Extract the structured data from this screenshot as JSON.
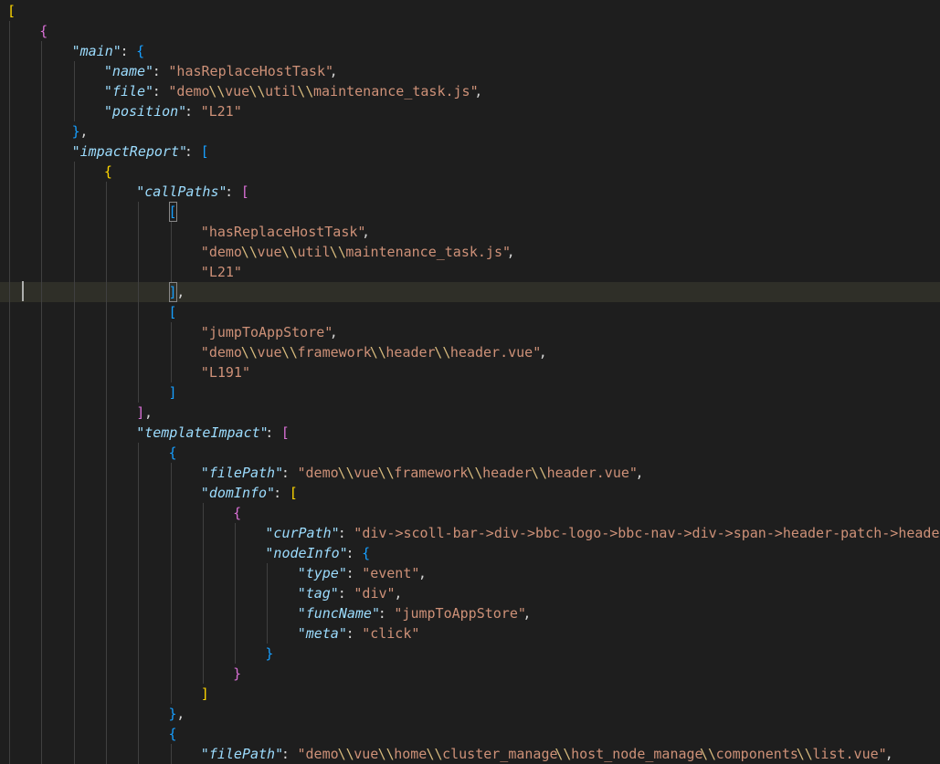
{
  "editor": {
    "language": "json",
    "theme": {
      "background": "#1e1e1e",
      "key_color": "#9cdcfe",
      "string_color": "#ce9178",
      "escape_color": "#d7ba7d",
      "bracket_colors": [
        "#ffd700",
        "#da70d6",
        "#179fff"
      ]
    },
    "current_line": 14,
    "lines": [
      {
        "indent": 0,
        "tokens": [
          {
            "t": "[",
            "c": "b-gold"
          }
        ]
      },
      {
        "indent": 1,
        "tokens": [
          {
            "t": "{",
            "c": "b-purple"
          }
        ]
      },
      {
        "indent": 2,
        "tokens": [
          {
            "t": "\"main\"",
            "c": "t-key"
          },
          {
            "t": ": ",
            "c": "t-punc"
          },
          {
            "t": "{",
            "c": "b-blue"
          }
        ]
      },
      {
        "indent": 3,
        "tokens": [
          {
            "t": "\"name\"",
            "c": "t-key"
          },
          {
            "t": ": ",
            "c": "t-punc"
          },
          {
            "t": "\"hasReplaceHostTask\"",
            "c": "t-str"
          },
          {
            "t": ",",
            "c": "t-punc"
          }
        ]
      },
      {
        "indent": 3,
        "tokens": [
          {
            "t": "\"file\"",
            "c": "t-key"
          },
          {
            "t": ": ",
            "c": "t-punc"
          },
          {
            "t": "\"demo",
            "c": "t-str"
          },
          {
            "t": "\\\\",
            "c": "t-esc"
          },
          {
            "t": "vue",
            "c": "t-str"
          },
          {
            "t": "\\\\",
            "c": "t-esc"
          },
          {
            "t": "util",
            "c": "t-str"
          },
          {
            "t": "\\\\",
            "c": "t-esc"
          },
          {
            "t": "maintenance_task.js\"",
            "c": "t-str"
          },
          {
            "t": ",",
            "c": "t-punc"
          }
        ]
      },
      {
        "indent": 3,
        "tokens": [
          {
            "t": "\"position\"",
            "c": "t-key"
          },
          {
            "t": ": ",
            "c": "t-punc"
          },
          {
            "t": "\"L21\"",
            "c": "t-str"
          }
        ]
      },
      {
        "indent": 2,
        "tokens": [
          {
            "t": "}",
            "c": "b-blue"
          },
          {
            "t": ",",
            "c": "t-punc"
          }
        ]
      },
      {
        "indent": 2,
        "tokens": [
          {
            "t": "\"impactReport\"",
            "c": "t-key"
          },
          {
            "t": ": ",
            "c": "t-punc"
          },
          {
            "t": "[",
            "c": "b-blue"
          }
        ]
      },
      {
        "indent": 3,
        "tokens": [
          {
            "t": "{",
            "c": "b-gold"
          }
        ]
      },
      {
        "indent": 4,
        "tokens": [
          {
            "t": "\"callPaths\"",
            "c": "t-key"
          },
          {
            "t": ": ",
            "c": "t-punc"
          },
          {
            "t": "[",
            "c": "b-purple"
          }
        ]
      },
      {
        "indent": 5,
        "tokens": [
          {
            "t": "[",
            "c": "b-blue",
            "match": true
          }
        ]
      },
      {
        "indent": 6,
        "tokens": [
          {
            "t": "\"hasReplaceHostTask\"",
            "c": "t-str"
          },
          {
            "t": ",",
            "c": "t-punc"
          }
        ]
      },
      {
        "indent": 6,
        "tokens": [
          {
            "t": "\"demo",
            "c": "t-str"
          },
          {
            "t": "\\\\",
            "c": "t-esc"
          },
          {
            "t": "vue",
            "c": "t-str"
          },
          {
            "t": "\\\\",
            "c": "t-esc"
          },
          {
            "t": "util",
            "c": "t-str"
          },
          {
            "t": "\\\\",
            "c": "t-esc"
          },
          {
            "t": "maintenance_task.js\"",
            "c": "t-str"
          },
          {
            "t": ",",
            "c": "t-punc"
          }
        ]
      },
      {
        "indent": 6,
        "tokens": [
          {
            "t": "\"L21\"",
            "c": "t-str"
          }
        ]
      },
      {
        "indent": 5,
        "tokens": [
          {
            "t": "]",
            "c": "b-blue",
            "match": true
          },
          {
            "t": ",",
            "c": "t-punc"
          }
        ]
      },
      {
        "indent": 5,
        "tokens": [
          {
            "t": "[",
            "c": "b-blue"
          }
        ]
      },
      {
        "indent": 6,
        "tokens": [
          {
            "t": "\"jumpToAppStore\"",
            "c": "t-str"
          },
          {
            "t": ",",
            "c": "t-punc"
          }
        ]
      },
      {
        "indent": 6,
        "tokens": [
          {
            "t": "\"demo",
            "c": "t-str"
          },
          {
            "t": "\\\\",
            "c": "t-esc"
          },
          {
            "t": "vue",
            "c": "t-str"
          },
          {
            "t": "\\\\",
            "c": "t-esc"
          },
          {
            "t": "framework",
            "c": "t-str"
          },
          {
            "t": "\\\\",
            "c": "t-esc"
          },
          {
            "t": "header",
            "c": "t-str"
          },
          {
            "t": "\\\\",
            "c": "t-esc"
          },
          {
            "t": "header.vue\"",
            "c": "t-str"
          },
          {
            "t": ",",
            "c": "t-punc"
          }
        ]
      },
      {
        "indent": 6,
        "tokens": [
          {
            "t": "\"L191\"",
            "c": "t-str"
          }
        ]
      },
      {
        "indent": 5,
        "tokens": [
          {
            "t": "]",
            "c": "b-blue"
          }
        ]
      },
      {
        "indent": 4,
        "tokens": [
          {
            "t": "]",
            "c": "b-purple"
          },
          {
            "t": ",",
            "c": "t-punc"
          }
        ]
      },
      {
        "indent": 4,
        "tokens": [
          {
            "t": "\"templateImpact\"",
            "c": "t-key"
          },
          {
            "t": ": ",
            "c": "t-punc"
          },
          {
            "t": "[",
            "c": "b-purple"
          }
        ]
      },
      {
        "indent": 5,
        "tokens": [
          {
            "t": "{",
            "c": "b-blue"
          }
        ]
      },
      {
        "indent": 6,
        "tokens": [
          {
            "t": "\"filePath\"",
            "c": "t-key"
          },
          {
            "t": ": ",
            "c": "t-punc"
          },
          {
            "t": "\"demo",
            "c": "t-str"
          },
          {
            "t": "\\\\",
            "c": "t-esc"
          },
          {
            "t": "vue",
            "c": "t-str"
          },
          {
            "t": "\\\\",
            "c": "t-esc"
          },
          {
            "t": "framework",
            "c": "t-str"
          },
          {
            "t": "\\\\",
            "c": "t-esc"
          },
          {
            "t": "header",
            "c": "t-str"
          },
          {
            "t": "\\\\",
            "c": "t-esc"
          },
          {
            "t": "header.vue\"",
            "c": "t-str"
          },
          {
            "t": ",",
            "c": "t-punc"
          }
        ]
      },
      {
        "indent": 6,
        "tokens": [
          {
            "t": "\"domInfo\"",
            "c": "t-key"
          },
          {
            "t": ": ",
            "c": "t-punc"
          },
          {
            "t": "[",
            "c": "b-gold"
          }
        ]
      },
      {
        "indent": 7,
        "tokens": [
          {
            "t": "{",
            "c": "b-purple"
          }
        ]
      },
      {
        "indent": 8,
        "tokens": [
          {
            "t": "\"curPath\"",
            "c": "t-key"
          },
          {
            "t": ": ",
            "c": "t-punc"
          },
          {
            "t": "\"div->scoll-bar->div->bbc-logo->bbc-nav->div->span->header-patch->header-t",
            "c": "t-str"
          }
        ]
      },
      {
        "indent": 8,
        "tokens": [
          {
            "t": "\"nodeInfo\"",
            "c": "t-key"
          },
          {
            "t": ": ",
            "c": "t-punc"
          },
          {
            "t": "{",
            "c": "b-blue"
          }
        ]
      },
      {
        "indent": 9,
        "tokens": [
          {
            "t": "\"type\"",
            "c": "t-key"
          },
          {
            "t": ": ",
            "c": "t-punc"
          },
          {
            "t": "\"event\"",
            "c": "t-str"
          },
          {
            "t": ",",
            "c": "t-punc"
          }
        ]
      },
      {
        "indent": 9,
        "tokens": [
          {
            "t": "\"tag\"",
            "c": "t-key"
          },
          {
            "t": ": ",
            "c": "t-punc"
          },
          {
            "t": "\"div\"",
            "c": "t-str"
          },
          {
            "t": ",",
            "c": "t-punc"
          }
        ]
      },
      {
        "indent": 9,
        "tokens": [
          {
            "t": "\"funcName\"",
            "c": "t-key"
          },
          {
            "t": ": ",
            "c": "t-punc"
          },
          {
            "t": "\"jumpToAppStore\"",
            "c": "t-str"
          },
          {
            "t": ",",
            "c": "t-punc"
          }
        ]
      },
      {
        "indent": 9,
        "tokens": [
          {
            "t": "\"meta\"",
            "c": "t-key"
          },
          {
            "t": ": ",
            "c": "t-punc"
          },
          {
            "t": "\"click\"",
            "c": "t-str"
          }
        ]
      },
      {
        "indent": 8,
        "tokens": [
          {
            "t": "}",
            "c": "b-blue"
          }
        ]
      },
      {
        "indent": 7,
        "tokens": [
          {
            "t": "}",
            "c": "b-purple"
          }
        ]
      },
      {
        "indent": 6,
        "tokens": [
          {
            "t": "]",
            "c": "b-gold"
          }
        ]
      },
      {
        "indent": 5,
        "tokens": [
          {
            "t": "}",
            "c": "b-blue"
          },
          {
            "t": ",",
            "c": "t-punc"
          }
        ]
      },
      {
        "indent": 5,
        "tokens": [
          {
            "t": "{",
            "c": "b-blue"
          }
        ]
      },
      {
        "indent": 6,
        "tokens": [
          {
            "t": "\"filePath\"",
            "c": "t-key"
          },
          {
            "t": ": ",
            "c": "t-punc"
          },
          {
            "t": "\"demo",
            "c": "t-str"
          },
          {
            "t": "\\\\",
            "c": "t-esc"
          },
          {
            "t": "vue",
            "c": "t-str"
          },
          {
            "t": "\\\\",
            "c": "t-esc"
          },
          {
            "t": "home",
            "c": "t-str"
          },
          {
            "t": "\\\\",
            "c": "t-esc"
          },
          {
            "t": "cluster_manage",
            "c": "t-str"
          },
          {
            "t": "\\\\",
            "c": "t-esc"
          },
          {
            "t": "host_node_manage",
            "c": "t-str"
          },
          {
            "t": "\\\\",
            "c": "t-esc"
          },
          {
            "t": "components",
            "c": "t-str"
          },
          {
            "t": "\\\\",
            "c": "t-esc"
          },
          {
            "t": "list.vue\"",
            "c": "t-str"
          },
          {
            "t": ",",
            "c": "t-punc"
          }
        ]
      }
    ]
  }
}
